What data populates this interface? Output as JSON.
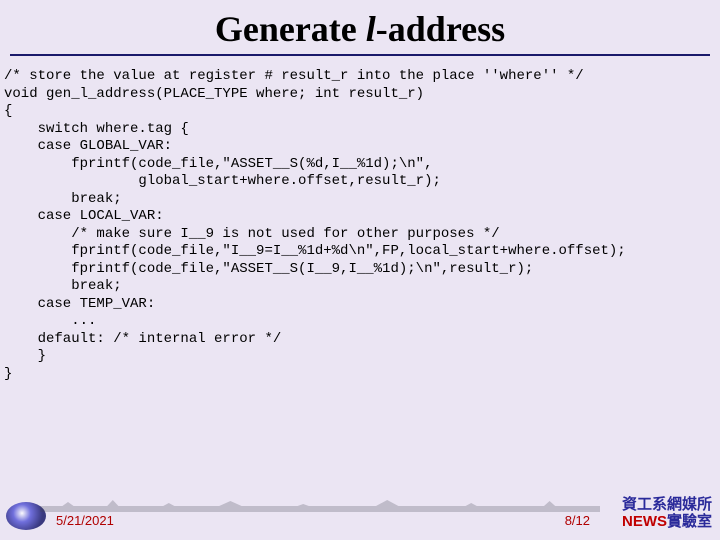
{
  "title_prefix": "Generate ",
  "title_ital": "l",
  "title_suffix": "-address",
  "code": "/* store the value at register # result_r into the place ''where'' */\nvoid gen_l_address(PLACE_TYPE where; int result_r)\n{\n    switch where.tag {\n    case GLOBAL_VAR:\n        fprintf(code_file,\"ASSET__S(%d,I__%1d);\\n\",\n                global_start+where.offset,result_r);\n        break;\n    case LOCAL_VAR:\n        /* make sure I__9 is not used for other purposes */\n        fprintf(code_file,\"I__9=I__%1d+%d\\n\",FP,local_start+where.offset);\n        fprintf(code_file,\"ASSET__S(I__9,I__%1d);\\n\",result_r);\n        break;\n    case TEMP_VAR:\n        ...\n    default: /* internal error */\n    }\n}",
  "footer": {
    "date": "5/21/2021",
    "page": "8/12",
    "lab_line1": "資工系網媒所",
    "lab_line2_a": "NEWS",
    "lab_line2_b": "實驗室"
  }
}
